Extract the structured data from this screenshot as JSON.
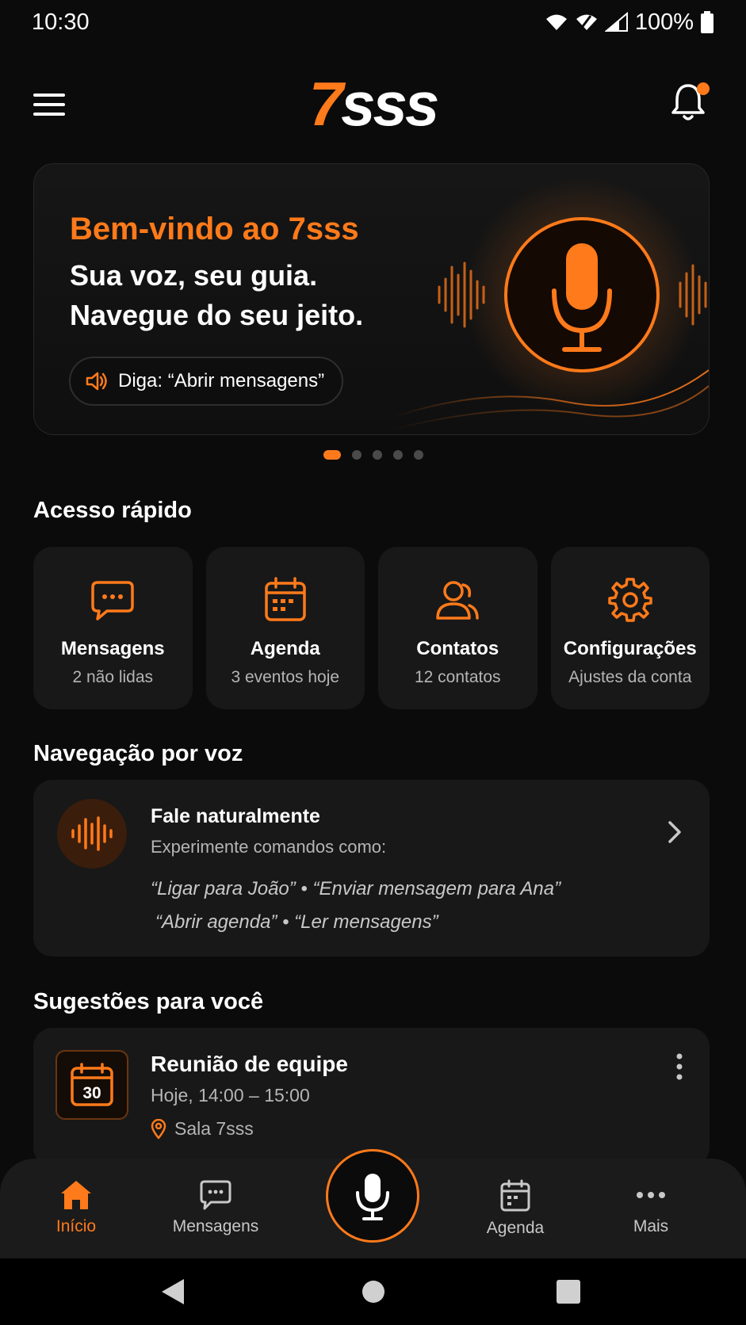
{
  "status_bar": {
    "time": "10:30",
    "battery": "100%"
  },
  "header": {
    "logo_seven": "7",
    "logo_rest": "sss"
  },
  "hero": {
    "title": "Bem-vindo ao 7sss",
    "line1": "Sua voz, seu guia.",
    "line2": "Navegue do seu jeito.",
    "voice_hint": "Diga: “Abrir mensagens”"
  },
  "carousel": {
    "total": 5,
    "active": 1
  },
  "quick_access": {
    "title": "Acesso rápido",
    "items": [
      {
        "label": "Mensagens",
        "sub": "2 não lidas",
        "icon": "chat-icon"
      },
      {
        "label": "Agenda",
        "sub": "3 eventos hoje",
        "icon": "calendar-icon"
      },
      {
        "label": "Contatos",
        "sub": "12 contatos",
        "icon": "contacts-icon"
      },
      {
        "label": "Configurações",
        "sub": "Ajustes da conta",
        "icon": "gear-icon"
      }
    ]
  },
  "voice_nav": {
    "title": "Navegação por voz",
    "card_title": "Fale naturalmente",
    "card_sub": "Experimente comandos como:",
    "commands_line1": "“Ligar para João” • “Enviar mensagem para Ana”",
    "commands_line2": "“Abrir agenda” • “Ler mensagens”"
  },
  "suggestions": {
    "title": "Sugestões para você",
    "items": [
      {
        "day": "30",
        "title": "Reunião de equipe",
        "time": "Hoje, 14:00 – 15:00",
        "location": "Sala 7sss"
      }
    ]
  },
  "bottom_nav": {
    "items": [
      {
        "label": "Início",
        "icon": "home-icon",
        "active": true
      },
      {
        "label": "Mensagens",
        "icon": "chat-icon",
        "active": false
      },
      {
        "label": "Agenda",
        "icon": "calendar-icon",
        "active": false
      },
      {
        "label": "Mais",
        "icon": "more-icon",
        "active": false
      }
    ]
  },
  "colors": {
    "accent": "#ff7a1a",
    "background": "#0b0b0b",
    "card": "#181818"
  }
}
